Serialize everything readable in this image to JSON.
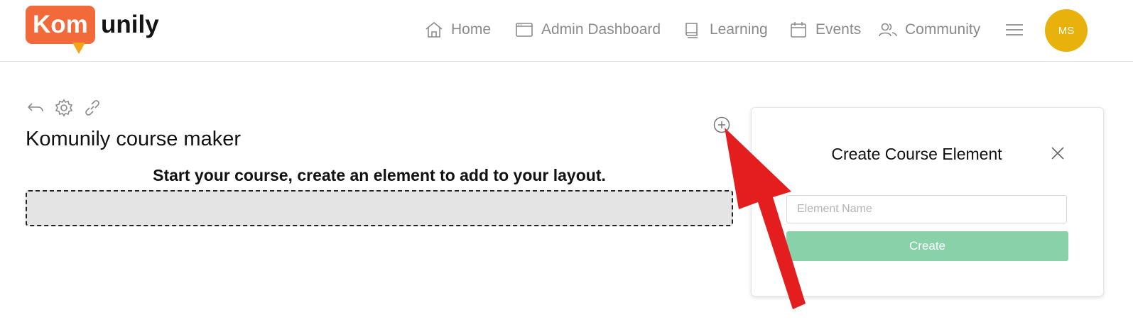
{
  "header": {
    "logo": {
      "badge_text": "Kom",
      "text": "unily",
      "badge_color": "#f26a3a",
      "tail_color": "#f5a31a"
    },
    "nav": [
      {
        "label": "Home",
        "icon": "home-icon"
      },
      {
        "label": "Admin Dashboard",
        "icon": "window-icon"
      },
      {
        "label": "Learning",
        "icon": "book-icon"
      },
      {
        "label": "Events",
        "icon": "calendar-icon"
      },
      {
        "label": "Community",
        "icon": "users-icon"
      }
    ],
    "menu_icon": "hamburger-icon",
    "avatar": {
      "initials": "MS",
      "color": "#e8b10c"
    }
  },
  "toolbar": {
    "icons": [
      "undo-icon",
      "gear-icon",
      "link-icon"
    ]
  },
  "main": {
    "title": "Komunily course maker",
    "add_icon": "plus-circle-icon",
    "instruction": "Start your course, create an element to add to your layout."
  },
  "panel": {
    "title": "Create Course Element",
    "close_icon": "close-icon",
    "input_placeholder": "Element Name",
    "input_value": "",
    "create_label": "Create",
    "create_color": "#89d1a8"
  },
  "annotation": {
    "arrow_color": "#e41e1e"
  }
}
